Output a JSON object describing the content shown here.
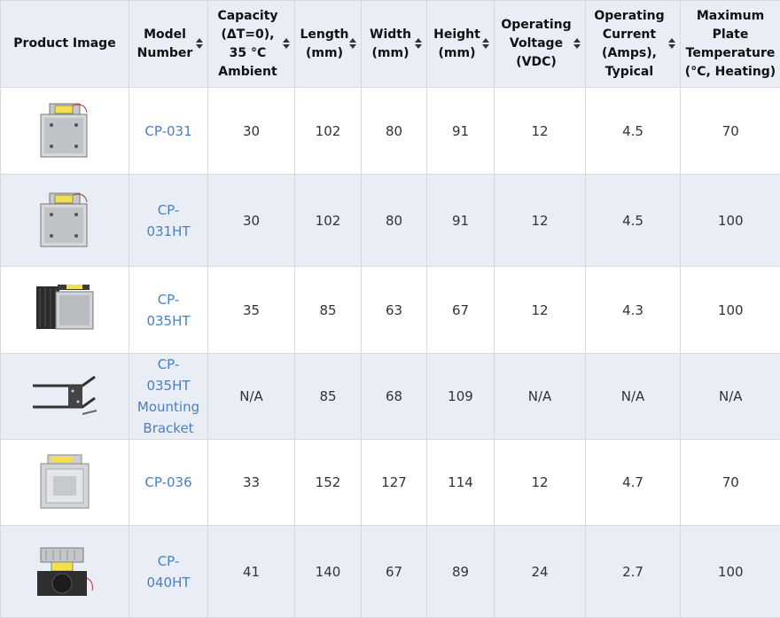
{
  "table": {
    "headers": [
      {
        "key": "image",
        "label": "Product Image",
        "sortable": false
      },
      {
        "key": "model",
        "label": "Model Number",
        "sortable": true
      },
      {
        "key": "capacity",
        "label": "Capacity (ΔT=0), 35 °C Ambient",
        "sortable": true
      },
      {
        "key": "length",
        "label": "Length (mm)",
        "sortable": true
      },
      {
        "key": "width",
        "label": "Width (mm)",
        "sortable": true
      },
      {
        "key": "height",
        "label": "Height (mm)",
        "sortable": true
      },
      {
        "key": "voltage",
        "label": "Operating Voltage (VDC)",
        "sortable": true
      },
      {
        "key": "current",
        "label": "Operating Current (Amps), Typical",
        "sortable": true
      },
      {
        "key": "maxtemp",
        "label": "Maximum Plate Temperature (°C, Heating)",
        "sortable": false
      }
    ],
    "rows": [
      {
        "image": "cooler-with-yellow-label-thumbnail",
        "model": "CP-031",
        "capacity": "30",
        "length": "102",
        "width": "80",
        "height": "91",
        "voltage": "12",
        "current": "4.5",
        "maxtemp": "70"
      },
      {
        "image": "cooler-with-yellow-label-thumbnail",
        "model": "CP-031HT",
        "capacity": "30",
        "length": "102",
        "width": "80",
        "height": "91",
        "voltage": "12",
        "current": "4.5",
        "maxtemp": "100"
      },
      {
        "image": "finned-heatsink-cooler-thumbnail",
        "model": "CP-035HT",
        "capacity": "35",
        "length": "85",
        "width": "63",
        "height": "67",
        "voltage": "12",
        "current": "4.3",
        "maxtemp": "100"
      },
      {
        "image": "mounting-bracket-thumbnail",
        "model": "CP-035HT Mounting Bracket",
        "capacity": "N/A",
        "length": "85",
        "width": "68",
        "height": "109",
        "voltage": "N/A",
        "current": "N/A",
        "maxtemp": "N/A"
      },
      {
        "image": "box-cooler-thumbnail",
        "model": "CP-036",
        "capacity": "33",
        "length": "152",
        "width": "127",
        "height": "114",
        "voltage": "12",
        "current": "4.7",
        "maxtemp": "70"
      },
      {
        "image": "fan-cooler-thumbnail",
        "model": "CP-040HT",
        "capacity": "41",
        "length": "140",
        "width": "67",
        "height": "89",
        "voltage": "24",
        "current": "2.7",
        "maxtemp": "100"
      }
    ]
  },
  "colors": {
    "link": "#4a7fc1",
    "header_bg": "#e9edf5",
    "row_alt_bg": "#e9edf5",
    "border": "#d6d9de"
  }
}
